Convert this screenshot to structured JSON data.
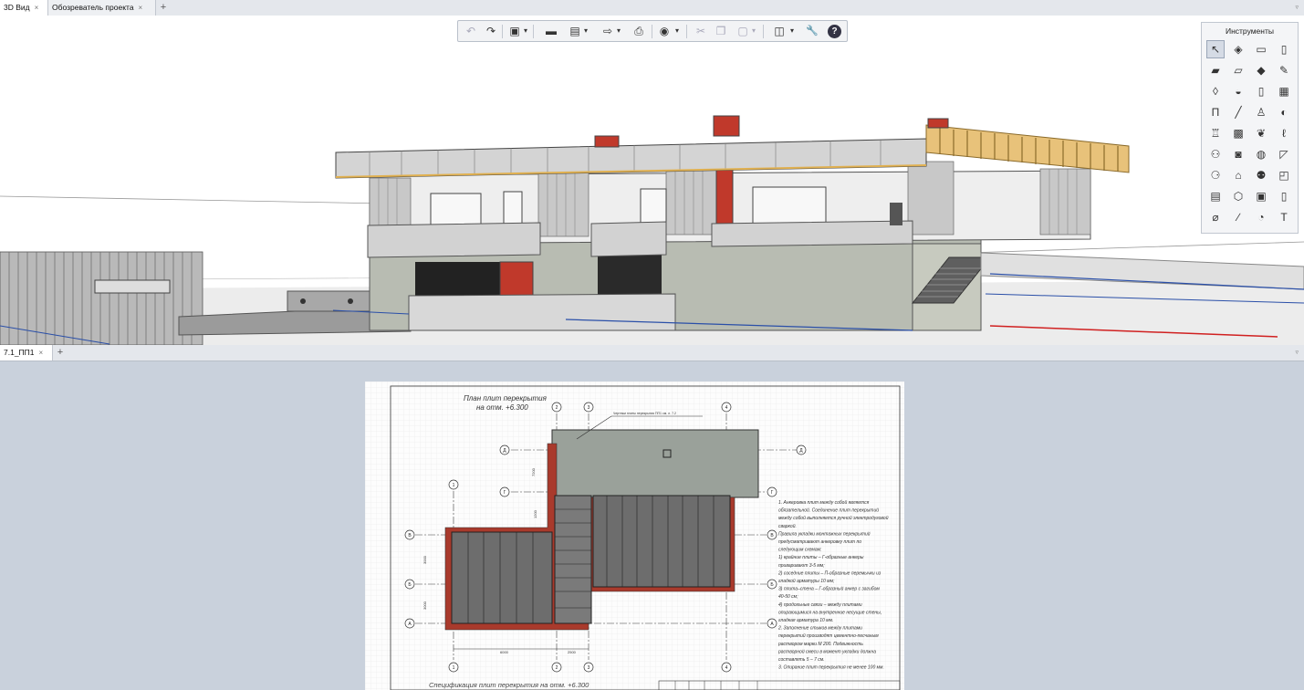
{
  "top_tabs": [
    {
      "label": "3D Вид",
      "close": "×",
      "active": true
    },
    {
      "label": "Обозреватель проекта",
      "close": "×",
      "active": false
    }
  ],
  "top_tab_add": "+",
  "top_tab_menu": "▿",
  "toolbar": {
    "buttons": [
      {
        "icon": "undo-icon",
        "glyph": "↶",
        "enabled": false
      },
      {
        "icon": "redo-icon",
        "glyph": "↷",
        "enabled": true
      },
      {
        "icon": "views-icon",
        "glyph": "▣",
        "enabled": true
      },
      {
        "icon": "open-folder-icon",
        "glyph": "▬",
        "enabled": true
      },
      {
        "icon": "save-icon",
        "glyph": "▤",
        "enabled": true
      },
      {
        "icon": "export-icon",
        "glyph": "⇨",
        "enabled": true
      },
      {
        "icon": "print-icon",
        "glyph": "⎙",
        "enabled": true
      },
      {
        "icon": "render-icon",
        "glyph": "◉",
        "enabled": true
      },
      {
        "icon": "cut-icon",
        "glyph": "✂",
        "enabled": false
      },
      {
        "icon": "copy-icon",
        "glyph": "❐",
        "enabled": false
      },
      {
        "icon": "paste-icon",
        "glyph": "▢",
        "enabled": false
      },
      {
        "icon": "layers-icon",
        "glyph": "◫",
        "enabled": true
      },
      {
        "icon": "settings-wrench-icon",
        "glyph": "🔧",
        "enabled": true
      },
      {
        "icon": "help-icon",
        "glyph": "?",
        "enabled": true
      }
    ],
    "dropdown_glyph": "▾"
  },
  "tools_panel": {
    "title": "Инструменты",
    "tools": [
      {
        "icon": "select-arrow-icon",
        "glyph": "↖",
        "active": true
      },
      {
        "icon": "tool-2-icon",
        "glyph": "◈"
      },
      {
        "icon": "wall-icon",
        "glyph": "▭"
      },
      {
        "icon": "column-icon",
        "glyph": "▯"
      },
      {
        "icon": "slab-icon",
        "glyph": "▰"
      },
      {
        "icon": "beam-icon",
        "glyph": "▱"
      },
      {
        "icon": "roof-icon",
        "glyph": "◆"
      },
      {
        "icon": "pencil-icon",
        "glyph": "✎"
      },
      {
        "icon": "tool-9-icon",
        "glyph": "◊"
      },
      {
        "icon": "shell-icon",
        "glyph": "◒"
      },
      {
        "icon": "door-icon",
        "glyph": "▯"
      },
      {
        "icon": "window-icon",
        "glyph": "▦"
      },
      {
        "icon": "stair-icon",
        "glyph": "Π"
      },
      {
        "icon": "line-icon",
        "glyph": "╱"
      },
      {
        "icon": "zone-icon",
        "glyph": "♙"
      },
      {
        "icon": "tool-16-icon",
        "glyph": "◐"
      },
      {
        "icon": "tool-17-icon",
        "glyph": "♖"
      },
      {
        "icon": "tool-18-icon",
        "glyph": "▩"
      },
      {
        "icon": "tool-19-icon",
        "glyph": "❦"
      },
      {
        "icon": "tool-20-icon",
        "glyph": "ℓ"
      },
      {
        "icon": "tool-21-icon",
        "glyph": "⚇"
      },
      {
        "icon": "tool-22-icon",
        "glyph": "◙"
      },
      {
        "icon": "tool-23-icon",
        "glyph": "◍"
      },
      {
        "icon": "tool-24-icon",
        "glyph": "◸"
      },
      {
        "icon": "tool-25-icon",
        "glyph": "⚆"
      },
      {
        "icon": "tool-26-icon",
        "glyph": "⌂"
      },
      {
        "icon": "tool-27-icon",
        "glyph": "⚉"
      },
      {
        "icon": "tool-28-icon",
        "glyph": "◰"
      },
      {
        "icon": "tool-29-icon",
        "glyph": "▤"
      },
      {
        "icon": "tool-30-icon",
        "glyph": "⬡"
      },
      {
        "icon": "tool-31-icon",
        "glyph": "▣"
      },
      {
        "icon": "tool-32-icon",
        "glyph": "▯"
      },
      {
        "icon": "tool-33-icon",
        "glyph": "⌀"
      },
      {
        "icon": "tool-34-icon",
        "glyph": "∕"
      },
      {
        "icon": "tool-35-icon",
        "glyph": "◔"
      },
      {
        "icon": "text-icon",
        "glyph": "T"
      }
    ]
  },
  "bottom_tabs": [
    {
      "label": "7.1_ПП1",
      "close": "×",
      "active": true
    }
  ],
  "bottom_tab_add": "+",
  "bottom_tab_menu": "▿",
  "drawing": {
    "title_line1": "План плит перекрытия",
    "title_line2": "на отм. +6.300",
    "leader_note": "Чертежи плиты перекрытия ПП1 см. л. 7.2",
    "dims": [
      "7200",
      "1200",
      "6000",
      "2500",
      "3000",
      "3000"
    ],
    "axes_horizontal": [
      "Д",
      "Г",
      "В",
      "Б",
      "А"
    ],
    "axes_vertical": [
      "1",
      "2",
      "3",
      "4"
    ],
    "notes": [
      "1. Анкеровка плит между собой является",
      "обязательной. Соединение плит перекрытий",
      "между собой выполняется ручной электродуговой",
      "сваркой.",
      "Правила укладки монтажных перекрытий",
      "предусматривают анкеровку плит по",
      "следующим схемам:",
      "1) крайние плиты – Г-образные анкеры",
      "приваривают 3-5 мм;",
      "2) соседние плиты – П-образные перемычки из",
      "гладкой арматуры 10 мм;",
      "3) плита–стена – Г-образный анкер с загибом",
      "40-50 см;",
      "4) продольные связи – между плитами",
      "опирающимися на внутренние несущие стены,",
      "гладкая арматура 10 мм.",
      "2. Заполнение стыков между плитами",
      "перекрытий производят цементно-песчаным",
      "раствором марки М 200. Подвижность",
      "растворной смеси в момент укладки должна",
      "составлять 5 – 7 см.",
      "3. Опирание плит перекрытия не менее 100 мм."
    ],
    "spec_title": "Спецификация плит перекрытия на отм. +6.300"
  }
}
